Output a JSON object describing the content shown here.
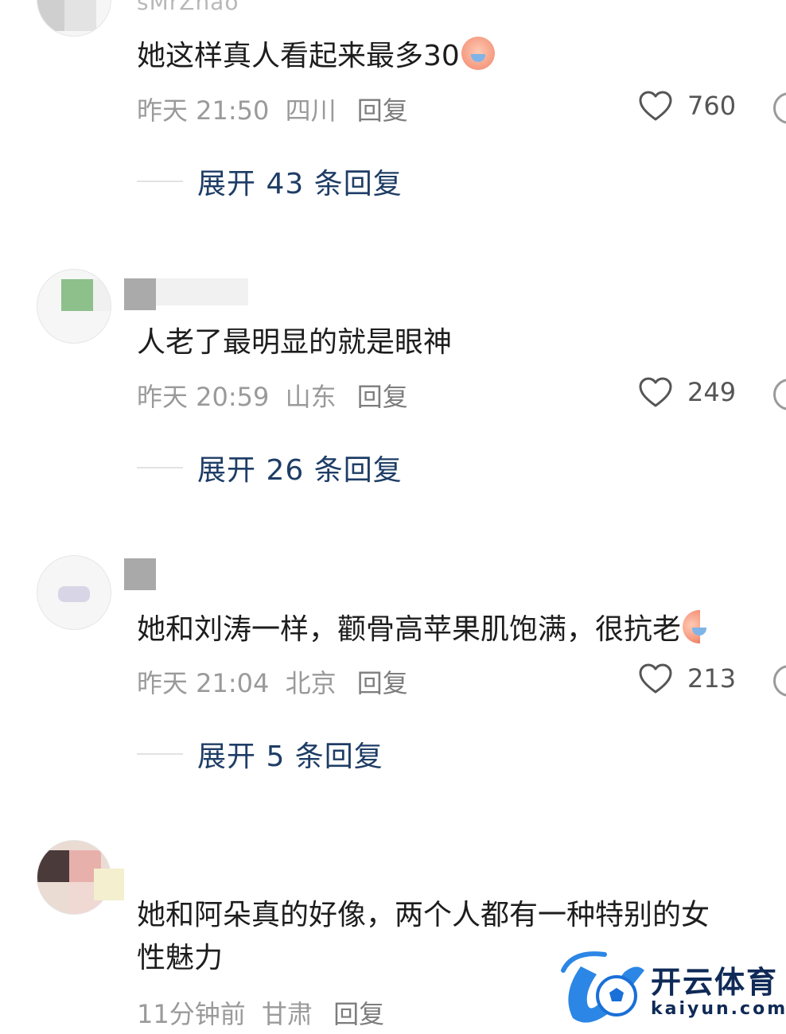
{
  "comments": [
    {
      "username": "sMrZhao",
      "text": "她这样真人看起来最多30",
      "time": "昨天 21:50",
      "location": "四川",
      "reply_label": "回复",
      "likes": "760",
      "expand_label": "展开 43 条回复"
    },
    {
      "username": "",
      "text": "人老了最明显的就是眼神",
      "time": "昨天 20:59",
      "location": "山东",
      "reply_label": "回复",
      "likes": "249",
      "expand_label": "展开 26 条回复"
    },
    {
      "username": "",
      "text": "她和刘涛一样，颧骨高苹果肌饱满，很抗老",
      "time": "昨天 21:04",
      "location": "北京",
      "reply_label": "回复",
      "likes": "213",
      "expand_label": "展开 5 条回复"
    },
    {
      "username": "",
      "text_line1": "她和阿朵真的好像，两个人都有一种特别的女",
      "text_line2": "性魅力",
      "time": "11分钟前",
      "location": "甘肃",
      "reply_label": "回复"
    }
  ],
  "watermark": {
    "brand": "开云体育",
    "domain": "kaiyun.com"
  },
  "icons": {
    "like": "heart-outline-icon",
    "more": "more-circle-icon",
    "emoji": "crying-emoji-icon"
  },
  "colors": {
    "expand_link": "#1e3d66",
    "meta_text": "#9a9a9a",
    "watermark_blue": "#1a6fd8"
  }
}
